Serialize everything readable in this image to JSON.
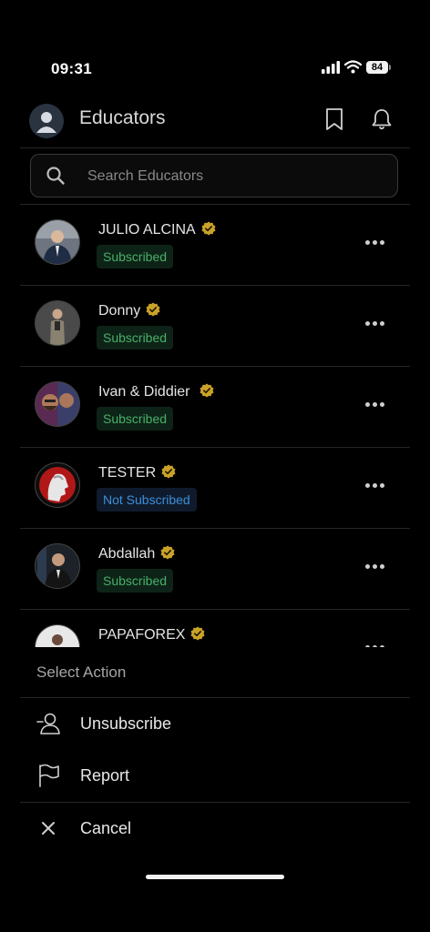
{
  "status_bar": {
    "time": "09:31",
    "battery": "84"
  },
  "header": {
    "title": "Educators"
  },
  "search": {
    "placeholder": "Search Educators"
  },
  "educators": [
    {
      "name": "JULIO ALCINA",
      "status": "Subscribed"
    },
    {
      "name": "Donny",
      "status": "Subscribed"
    },
    {
      "name": "Ivan & Diddier ",
      "status": "Subscribed"
    },
    {
      "name": "TESTER",
      "status": "Not Subscribed"
    },
    {
      "name": "Abdallah",
      "status": "Subscribed"
    },
    {
      "name": "PAPAFOREX",
      "status": ""
    }
  ],
  "sheet": {
    "title": "Select Action",
    "actions": [
      {
        "label": "Unsubscribe",
        "icon": "user-minus-icon"
      },
      {
        "label": "Report",
        "icon": "flag-icon"
      },
      {
        "label": "Cancel",
        "icon": "close-icon"
      }
    ]
  },
  "colors": {
    "verified": "#c9a227",
    "subscribed": "#46b069",
    "not_subscribed": "#3d8fd8",
    "background": "#000000"
  }
}
